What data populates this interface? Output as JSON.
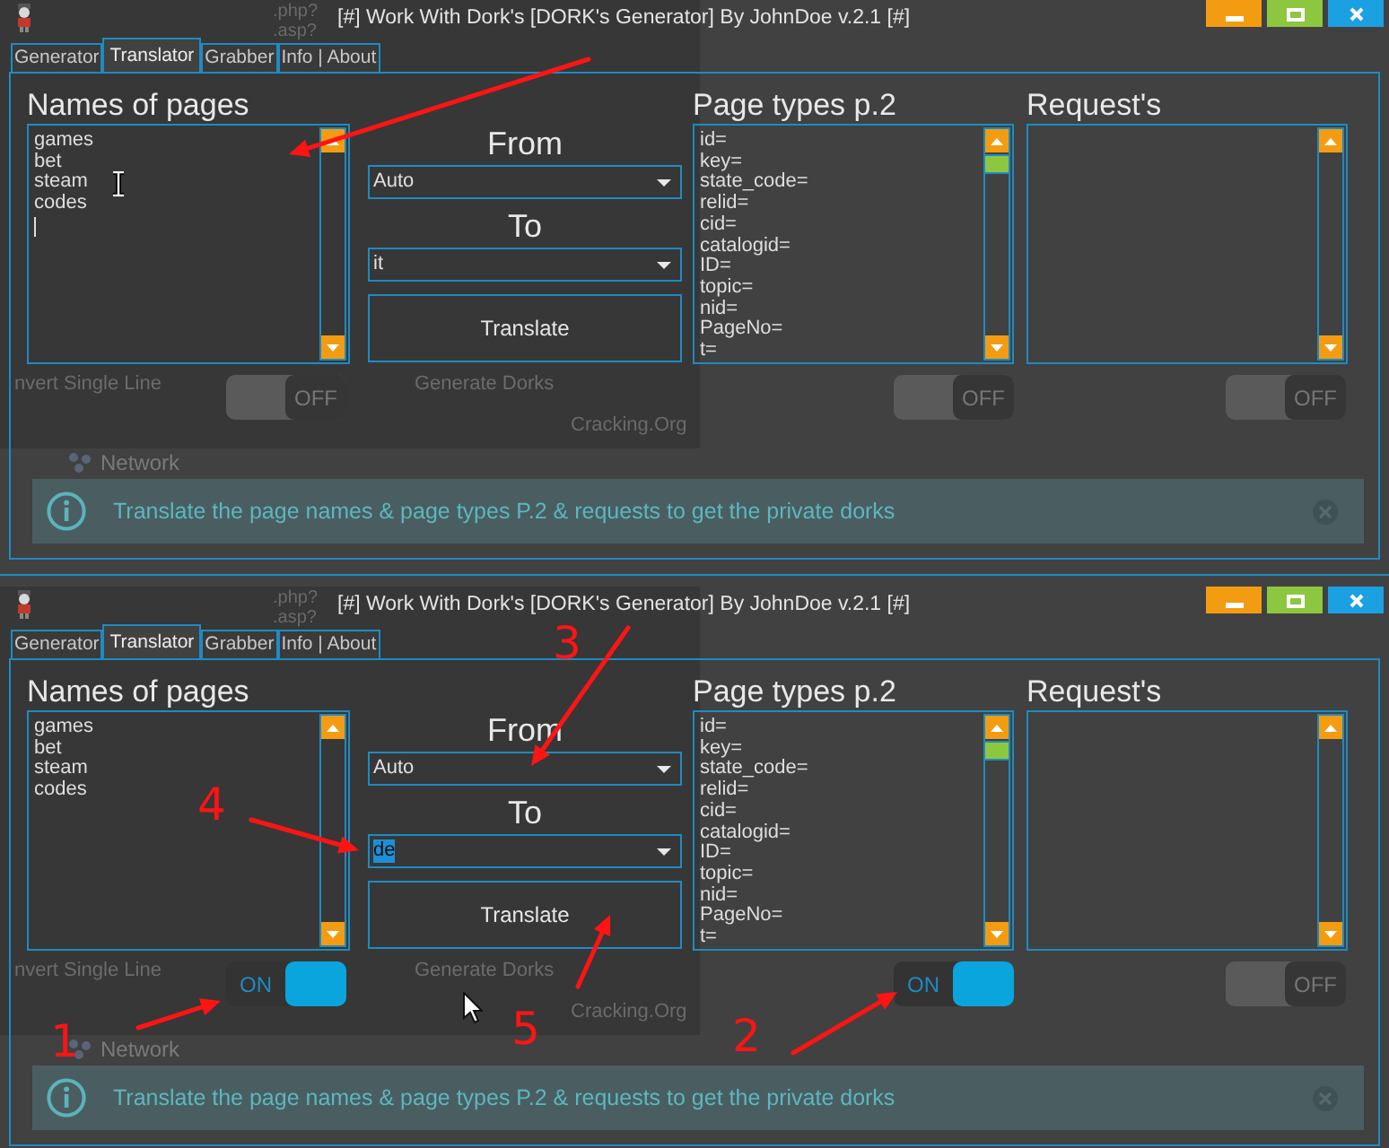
{
  "windows": [
    {
      "title": "[#] Work With Dork's [DORK's Generator] By JohnDoe v.2.1 [#]",
      "tabs": [
        {
          "label": "Generator",
          "selected": false
        },
        {
          "label": "Translator",
          "selected": true
        },
        {
          "label": "Grabber",
          "selected": false
        },
        {
          "label": "Info | About",
          "selected": false
        }
      ],
      "names_of_pages": {
        "heading": "Names of pages",
        "lines": [
          "games",
          "bet",
          "steam",
          "codes"
        ],
        "focused": true,
        "scroll_thumb": false,
        "toggle": {
          "label": "OFF",
          "on": false
        }
      },
      "translate": {
        "from_label": "From",
        "from_value": "Auto",
        "to_label": "To",
        "to_value": "it",
        "to_value_selected": false,
        "button": "Translate"
      },
      "page_types": {
        "heading": "Page types p.2",
        "items": [
          "id=",
          "key=",
          "state_code=",
          "relid=",
          "cid=",
          "catalogid=",
          "ID=",
          "topic=",
          "nid=",
          "PageNo=",
          "t="
        ],
        "scroll_thumb": true,
        "toggle": {
          "label": "OFF",
          "on": false
        }
      },
      "requests": {
        "heading": "Request's",
        "scroll_thumb": false,
        "toggle": {
          "label": "OFF",
          "on": false
        }
      },
      "background_window": {
        "extensions": [
          ".php?",
          ".asp?"
        ],
        "option": "nvert Single Line",
        "button": "Generate Dorks",
        "footer": "Cracking.Org",
        "section": "Network"
      },
      "info": {
        "text": "Translate the page names & page types P.2 & requests to get the private dorks"
      },
      "pointer": {
        "kind": "ibeam"
      },
      "annotations": [
        {
          "kind": "names-box"
        }
      ]
    },
    {
      "title": "[#] Work With Dork's [DORK's Generator] By JohnDoe v.2.1 [#]",
      "tabs": [
        {
          "label": "Generator",
          "selected": false
        },
        {
          "label": "Translator",
          "selected": true
        },
        {
          "label": "Grabber",
          "selected": false
        },
        {
          "label": "Info | About",
          "selected": false
        }
      ],
      "names_of_pages": {
        "heading": "Names of pages",
        "lines": [
          "games",
          "bet",
          "steam",
          "codes"
        ],
        "focused": false,
        "scroll_thumb": false,
        "toggle": {
          "label": "ON",
          "on": true
        }
      },
      "translate": {
        "from_label": "From",
        "from_value": "Auto",
        "to_label": "To",
        "to_value": "de",
        "to_value_selected": true,
        "button": "Translate"
      },
      "page_types": {
        "heading": "Page types p.2",
        "items": [
          "id=",
          "key=",
          "state_code=",
          "relid=",
          "cid=",
          "catalogid=",
          "ID=",
          "topic=",
          "nid=",
          "PageNo=",
          "t="
        ],
        "scroll_thumb": true,
        "toggle": {
          "label": "ON",
          "on": true
        }
      },
      "requests": {
        "heading": "Request's",
        "scroll_thumb": false,
        "toggle": {
          "label": "OFF",
          "on": false
        }
      },
      "background_window": {
        "extensions": [
          ".php?",
          ".asp?"
        ],
        "option": "nvert Single Line",
        "button": "Generate Dorks",
        "footer": "Cracking.Org",
        "section": "Network"
      },
      "info": {
        "text": "Translate the page names & page types P.2 & requests to get the private dorks"
      },
      "pointer": {
        "kind": "arrow"
      },
      "annotations": [
        {
          "kind": "names-toggle",
          "label": "1"
        },
        {
          "kind": "types-toggle",
          "label": "2"
        },
        {
          "kind": "from-select",
          "label": "3"
        },
        {
          "kind": "to-select",
          "label": "4"
        },
        {
          "kind": "translate-button",
          "label": "5"
        }
      ]
    }
  ]
}
